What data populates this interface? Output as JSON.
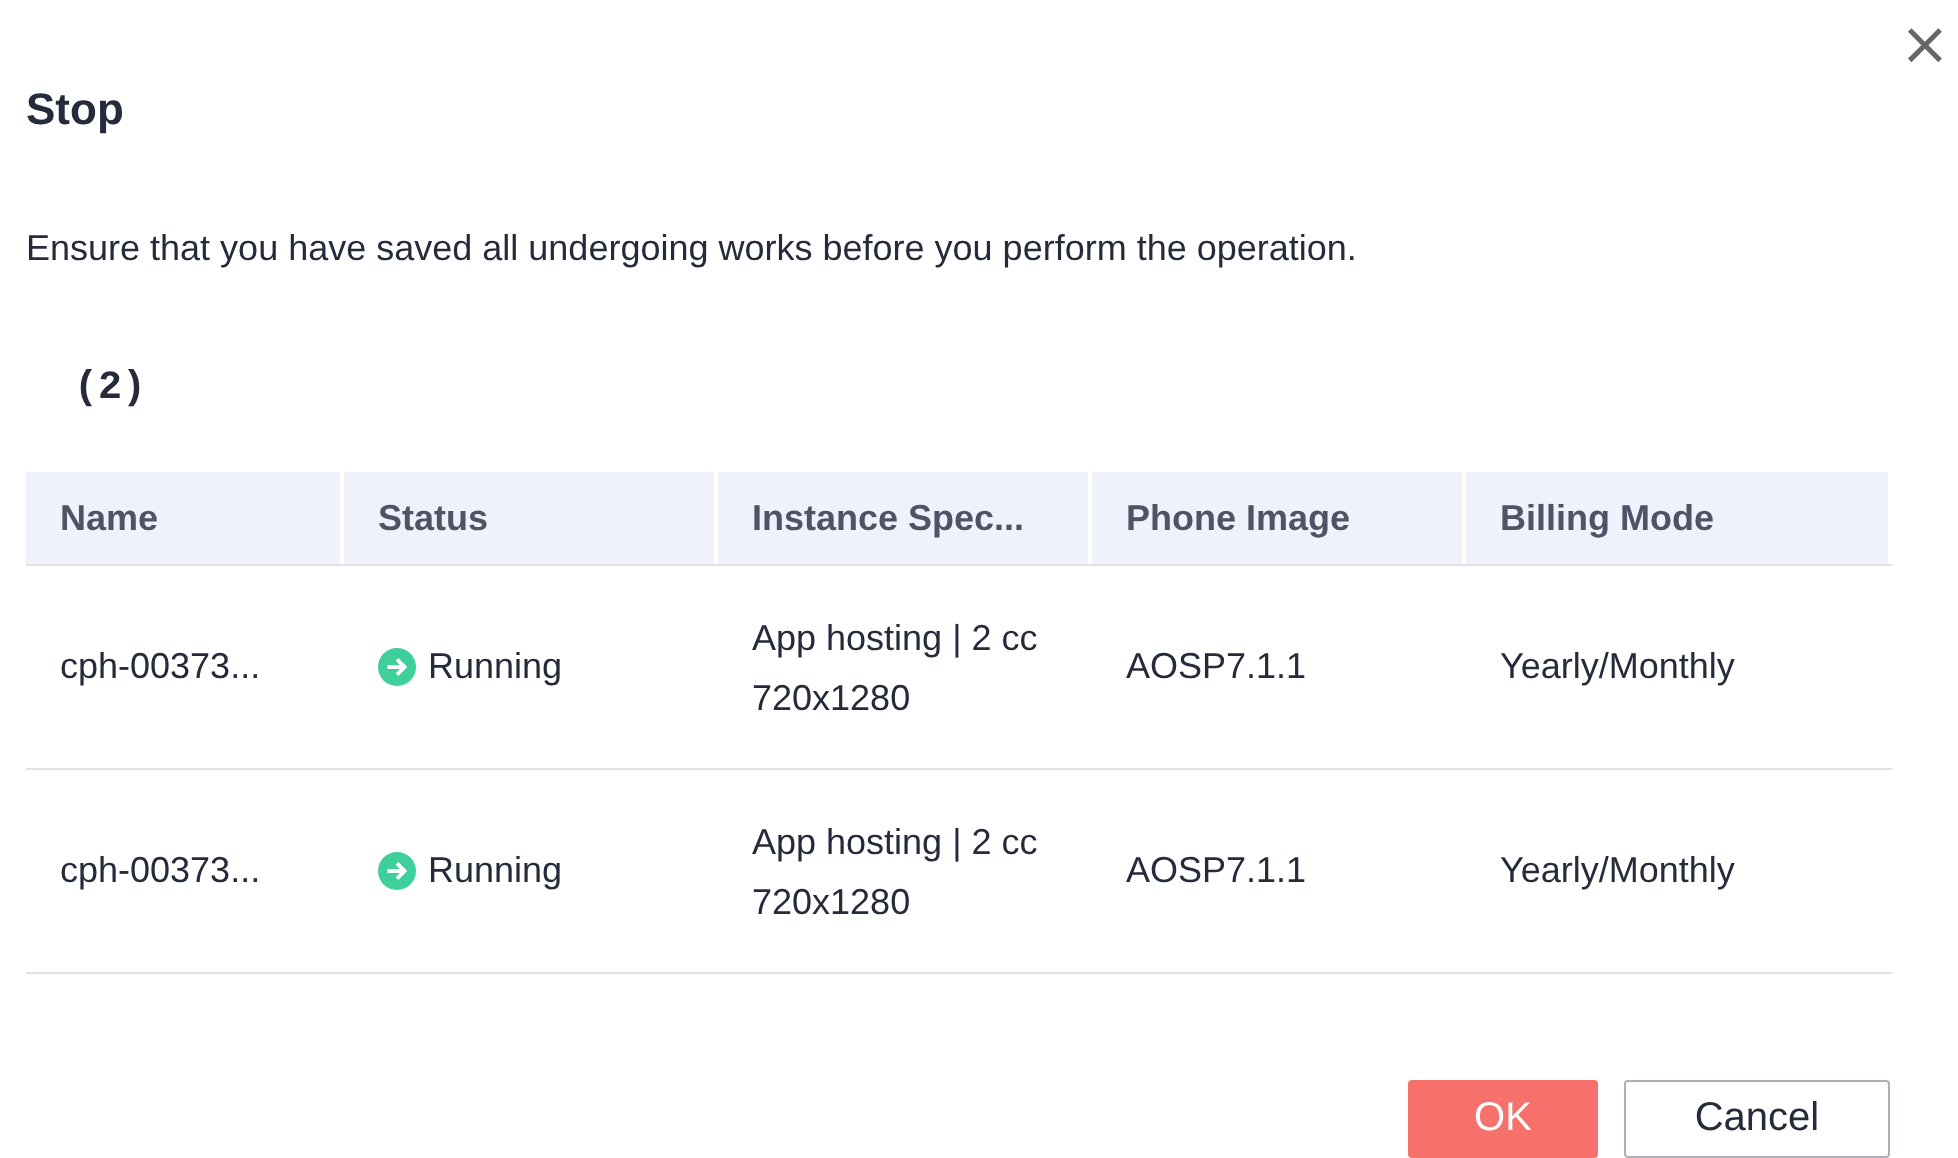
{
  "dialog": {
    "title": "Stop",
    "close": "×",
    "message": "Ensure that you have saved all undergoing works before you perform the operation.",
    "count": "(2)"
  },
  "table": {
    "columns": [
      "Name",
      "Status",
      "Instance Spec...",
      "Phone Image",
      "Billing Mode"
    ],
    "rows": [
      {
        "name": "cph-00373...",
        "status": "Running",
        "spec": [
          "App hosting | 2 cc",
          "720x1280"
        ],
        "image": "AOSP7.1.1",
        "billing": "Yearly/Monthly"
      },
      {
        "name": "cph-00373...",
        "status": "Running",
        "spec": [
          "App hosting | 2 cc",
          "720x1280"
        ],
        "image": "AOSP7.1.1",
        "billing": "Yearly/Monthly"
      }
    ]
  },
  "buttons": [
    {
      "label": "OK",
      "kind": "primary"
    },
    {
      "label": "Cancel",
      "kind": "secondary"
    }
  ]
}
